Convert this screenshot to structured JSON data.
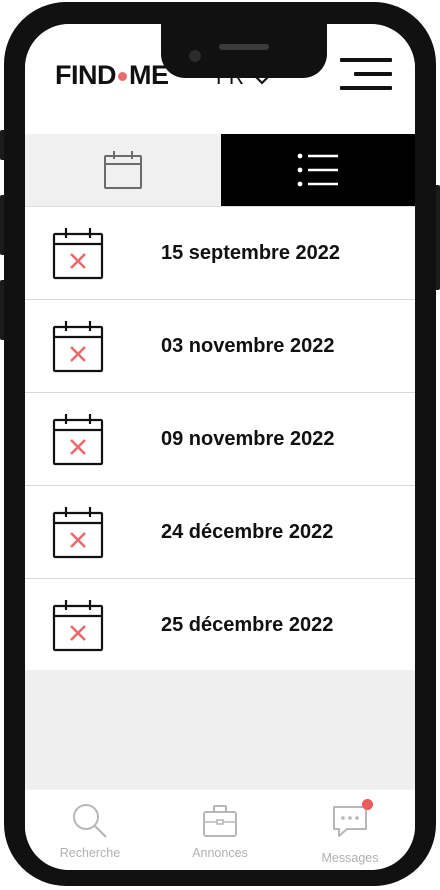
{
  "header": {
    "logo_left": "FIND",
    "logo_right": "ME",
    "language": "FR"
  },
  "tabs": [
    {
      "icon": "calendar-icon",
      "active": false
    },
    {
      "icon": "list-icon",
      "active": true
    }
  ],
  "dates": [
    {
      "label": "15 septembre 2022",
      "icon": "calendar-x-icon"
    },
    {
      "label": "03 novembre 2022",
      "icon": "calendar-x-icon"
    },
    {
      "label": "09 novembre 2022",
      "icon": "calendar-x-icon"
    },
    {
      "label": "24 décembre 2022",
      "icon": "calendar-x-icon"
    },
    {
      "label": "25 décembre 2022",
      "icon": "calendar-x-icon"
    }
  ],
  "bottom_nav": [
    {
      "label": "Recherche",
      "icon": "search-icon"
    },
    {
      "label": "Annonces",
      "icon": "briefcase-icon"
    },
    {
      "label": "Messages",
      "icon": "chat-icon",
      "has_badge": true
    }
  ],
  "colors": {
    "accent": "#e96b6b",
    "active_tab_bg": "#000000",
    "inactive_tab_bg": "#f0f0f0",
    "badge": "#ef5a5a"
  }
}
